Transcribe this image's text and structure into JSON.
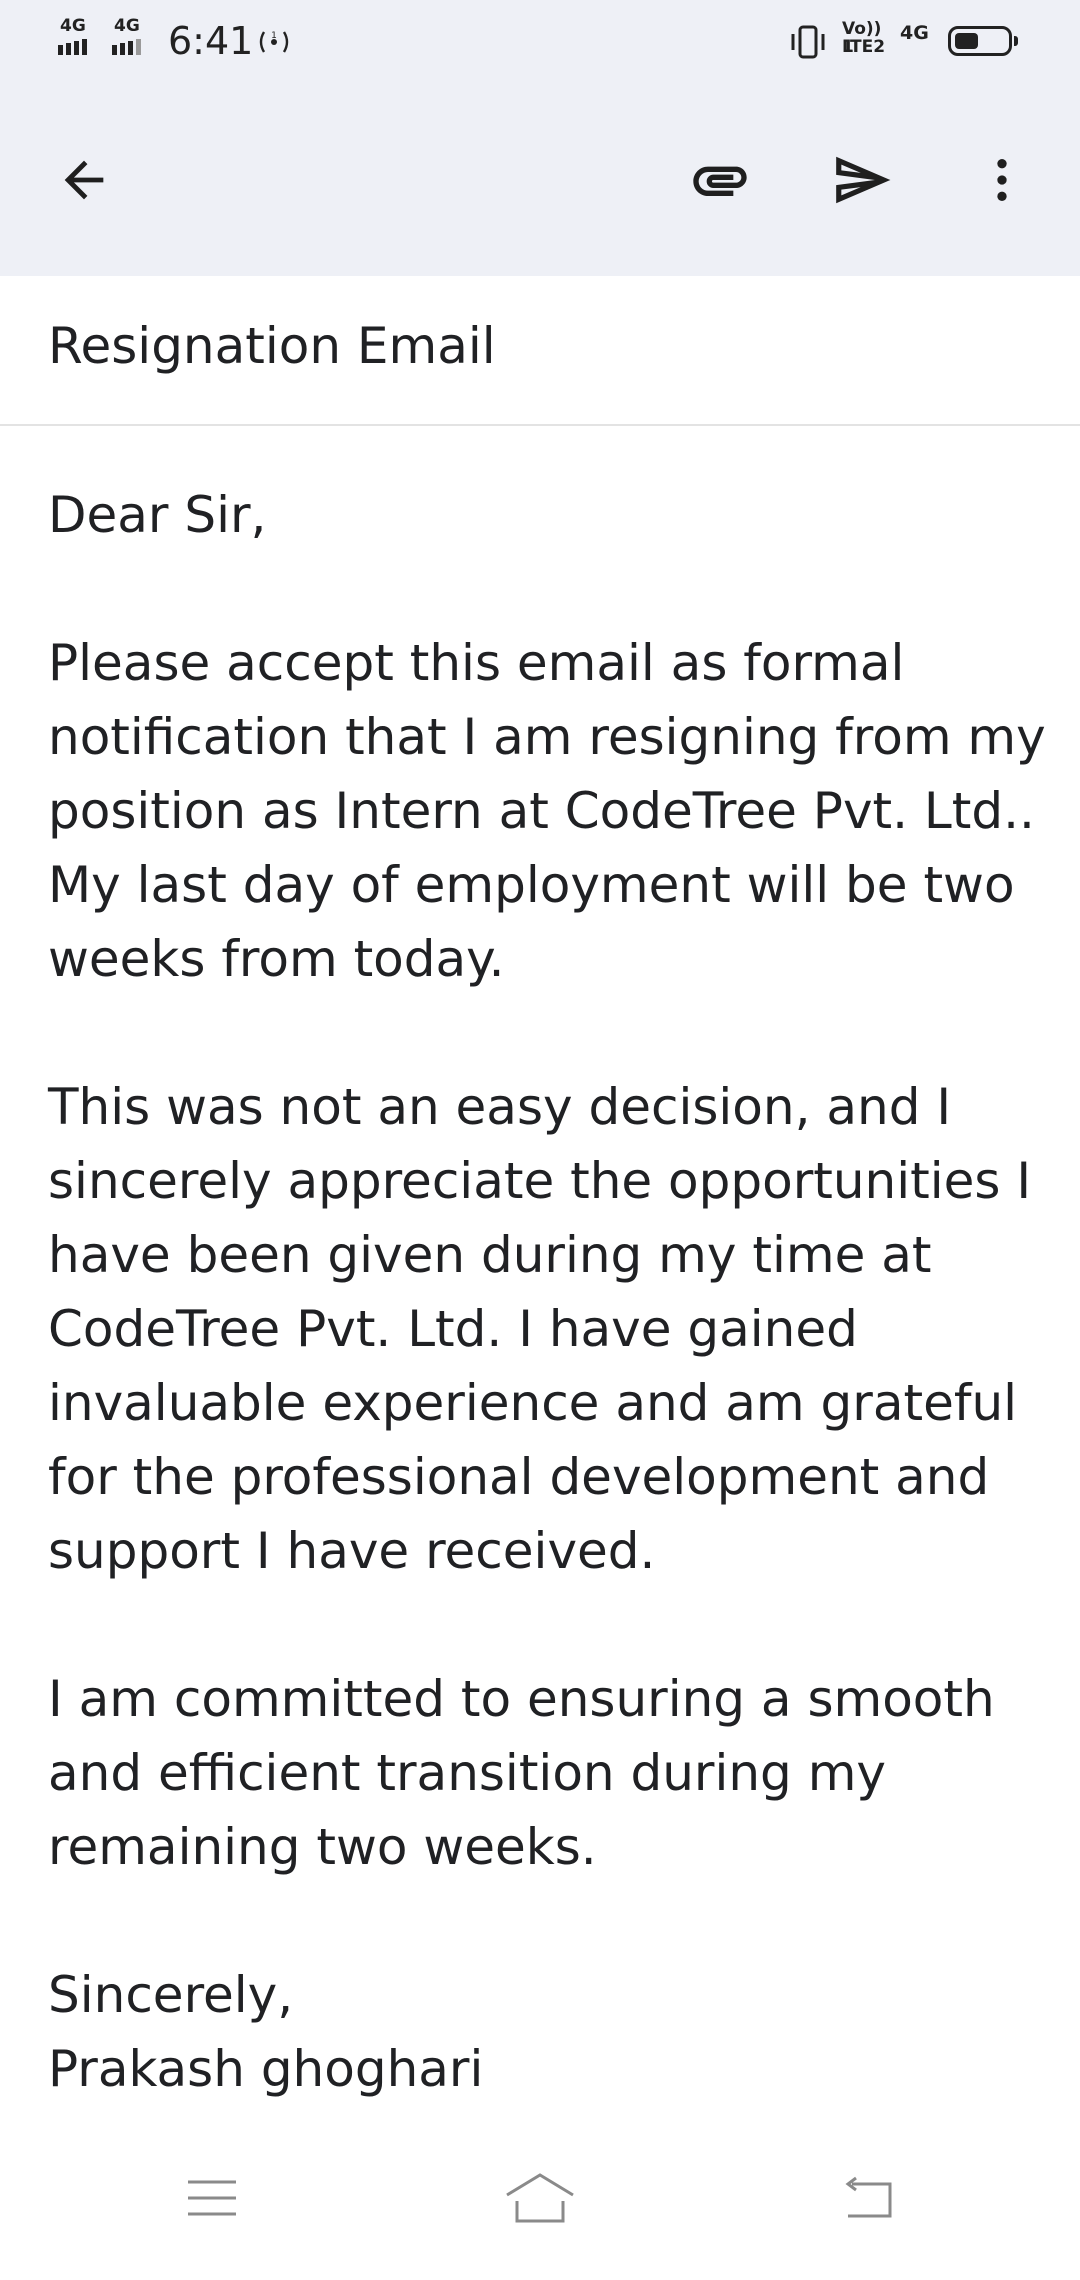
{
  "status_bar": {
    "sim1_network": "4G",
    "sim2_network": "4G",
    "time": "6:41",
    "volte_top": "Vo)) 1",
    "volte_bottom": "LTE2",
    "data_network": "4G",
    "battery_level": 0.45,
    "icons": [
      "signal-icon",
      "hotspot-icon",
      "vibrate-icon",
      "battery-icon"
    ]
  },
  "toolbar": {
    "icons": [
      "back-arrow-icon",
      "attachment-icon",
      "send-icon",
      "more-vert-icon"
    ]
  },
  "compose": {
    "subject": "Resignation Email",
    "body_paragraphs": [
      [
        "Dear Sir,"
      ],
      [
        "Please accept this email as formal",
        "notification that I am resigning from my",
        "position as Intern at CodeTree Pvt. Ltd..",
        "My last day of employment will be two",
        "weeks from today."
      ],
      [
        "This was not an easy decision, and I",
        "sincerely appreciate the opportunities I",
        "have been given during my time at",
        "CodeTree Pvt. Ltd. I have gained",
        "invaluable experience and am grateful",
        "for the professional development and",
        "support I have received."
      ],
      [
        "I am committed to ensuring a smooth",
        "and efficient transition during my",
        "remaining two weeks."
      ],
      [
        "Sincerely,",
        "Prakash ghoghari"
      ]
    ]
  },
  "nav_bar": {
    "icons": [
      "menu-icon",
      "home-icon",
      "back-icon"
    ]
  },
  "colors": {
    "toolbar_bg": "#eef0f6",
    "text": "#202124",
    "divider": "#e3e3e3"
  }
}
